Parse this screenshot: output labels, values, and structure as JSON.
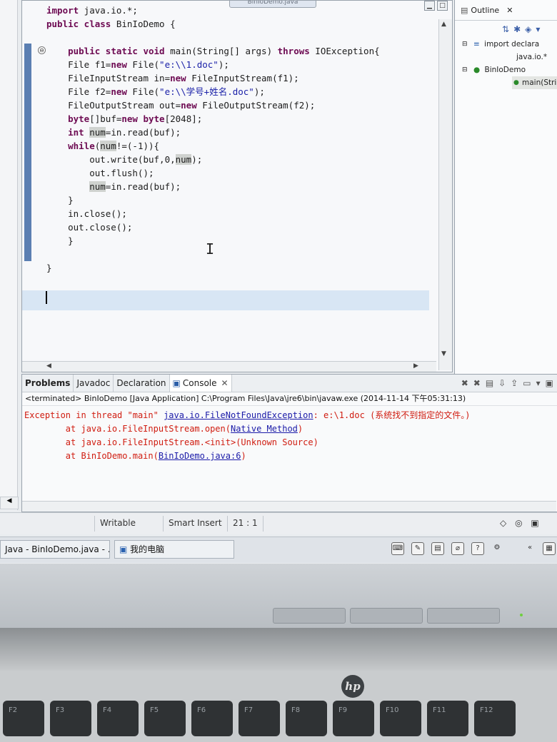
{
  "editor": {
    "tab_title": "BinIoDemo.java",
    "code": [
      [
        {
          "t": "import",
          "k": 1
        },
        {
          "t": " java.io.*;"
        }
      ],
      [
        {
          "t": "public class",
          "k": 1
        },
        {
          "t": " BinIoDemo {"
        }
      ],
      [
        {
          "t": ""
        }
      ],
      [
        {
          "t": "    "
        },
        {
          "t": "public static void",
          "k": 1
        },
        {
          "t": " main(String[] args) "
        },
        {
          "t": "throws",
          "k": 1
        },
        {
          "t": " IOException{"
        }
      ],
      [
        {
          "t": "    File f1="
        },
        {
          "t": "new",
          "k": 1
        },
        {
          "t": " File("
        },
        {
          "t": "\"e:\\\\1.doc\"",
          "s": 1
        },
        {
          "t": ");"
        }
      ],
      [
        {
          "t": "    FileInputStream in="
        },
        {
          "t": "new",
          "k": 1
        },
        {
          "t": " FileInputStream(f1);"
        }
      ],
      [
        {
          "t": "    File f2="
        },
        {
          "t": "new",
          "k": 1
        },
        {
          "t": " File("
        },
        {
          "t": "\"e:\\\\学号+姓名.doc\"",
          "s": 1
        },
        {
          "t": ");"
        }
      ],
      [
        {
          "t": "    FileOutputStream out="
        },
        {
          "t": "new",
          "k": 1
        },
        {
          "t": " FileOutputStream(f2);"
        }
      ],
      [
        {
          "t": "    "
        },
        {
          "t": "byte",
          "k": 1
        },
        {
          "t": "[]buf="
        },
        {
          "t": "new",
          "k": 1
        },
        {
          "t": " "
        },
        {
          "t": "byte",
          "k": 1
        },
        {
          "t": "[2048];"
        }
      ],
      [
        {
          "t": "    "
        },
        {
          "t": "int",
          "k": 1
        },
        {
          "t": " "
        },
        {
          "t": "num",
          "h": 1
        },
        {
          "t": "=in.read(buf);"
        }
      ],
      [
        {
          "t": "    "
        },
        {
          "t": "while",
          "k": 1
        },
        {
          "t": "("
        },
        {
          "t": "num",
          "h": 1
        },
        {
          "t": "!=(-1)){"
        }
      ],
      [
        {
          "t": "        out.write(buf,0,"
        },
        {
          "t": "num",
          "h": 1
        },
        {
          "t": ");"
        }
      ],
      [
        {
          "t": "        out.flush();"
        }
      ],
      [
        {
          "t": "        "
        },
        {
          "t": "num",
          "h": 1
        },
        {
          "t": "=in.read(buf);"
        }
      ],
      [
        {
          "t": "    }"
        }
      ],
      [
        {
          "t": "    in.close();"
        }
      ],
      [
        {
          "t": "    out.close();"
        }
      ],
      [
        {
          "t": "    }"
        }
      ],
      [
        {
          "t": ""
        }
      ],
      [
        {
          "t": "}"
        }
      ]
    ]
  },
  "outline": {
    "title": "Outline",
    "items": [
      {
        "label": "import declara",
        "icon": "import-icon"
      },
      {
        "label": "java.io.*",
        "icon": "package-icon"
      },
      {
        "label": "BinIoDemo",
        "icon": "class-icon"
      },
      {
        "label": "main(Strin",
        "icon": "method-icon"
      }
    ]
  },
  "bottom": {
    "tabs": [
      "Problems",
      "Javadoc",
      "Declaration",
      "Console"
    ],
    "terminated": "<terminated> BinIoDemo [Java Application] C:\\Program Files\\Java\\jre6\\bin\\javaw.exe (2014-11-14 下午05:31:13)",
    "console": {
      "l1_prefix": "Exception in thread \"main\" ",
      "l1_link": "java.io.FileNotFoundException",
      "l1_suffix": ": e:\\1.doc (系统找不到指定的文件。)",
      "l2_prefix": "        at java.io.FileInputStream.open(",
      "l2_link": "Native Method",
      "l2_suffix": ")",
      "l3": "        at java.io.FileInputStream.<init>(Unknown Source)",
      "l4_prefix": "        at BinIoDemo.main(",
      "l4_link": "BinIoDemo.java:6",
      "l4_suffix": ")"
    }
  },
  "status": {
    "writable": "Writable",
    "insert": "Smart Insert",
    "position": "21 : 1"
  },
  "taskbar": {
    "eclipse": "Java - BinIoDemo.java - ...",
    "computer": "我的电脑"
  },
  "hardware": {
    "brand": "hp",
    "keys": [
      "F2",
      "F3",
      "F4",
      "F5",
      "F6",
      "F7",
      "F8",
      "F9",
      "F10",
      "F11",
      "F12"
    ]
  }
}
